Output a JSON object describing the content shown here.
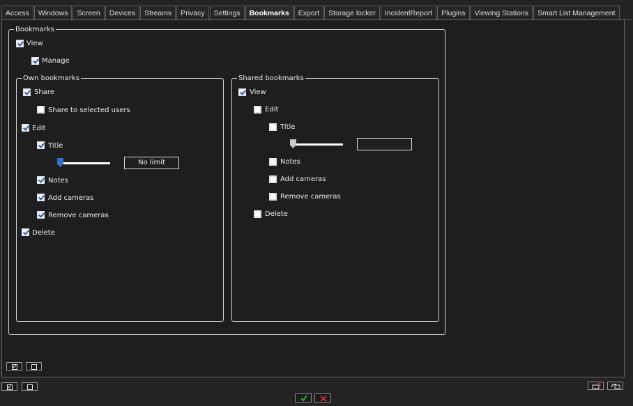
{
  "tabs": [
    {
      "label": "Access"
    },
    {
      "label": "Windows"
    },
    {
      "label": "Screen"
    },
    {
      "label": "Devices"
    },
    {
      "label": "Streams"
    },
    {
      "label": "Privacy"
    },
    {
      "label": "Settings"
    },
    {
      "label": "Bookmarks",
      "active": true
    },
    {
      "label": "Export"
    },
    {
      "label": "Storage locker"
    },
    {
      "label": "IncidentReport"
    },
    {
      "label": "Plugins"
    },
    {
      "label": "Viewing Stations"
    },
    {
      "label": "Smart List Management"
    }
  ],
  "bookmarks": {
    "title": "Bookmarks",
    "view": {
      "label": "View",
      "checked": true
    },
    "manage": {
      "label": "Manage",
      "checked": true
    }
  },
  "own": {
    "title": "Own bookmarks",
    "share": {
      "label": "Share",
      "checked": true
    },
    "share_selected": {
      "label": "Share to selected users",
      "checked": false
    },
    "edit": {
      "label": "Edit",
      "checked": true
    },
    "title_cb": {
      "label": "Title",
      "checked": true
    },
    "slider_value": "No limit",
    "slider_level": 0,
    "notes": {
      "label": "Notes",
      "checked": true
    },
    "add_cameras": {
      "label": "Add cameras",
      "checked": true
    },
    "remove_cameras": {
      "label": "Remove cameras",
      "checked": true
    },
    "delete": {
      "label": "Delete",
      "checked": true
    }
  },
  "shared": {
    "title": "Shared bookmarks",
    "view": {
      "label": "View",
      "checked": true
    },
    "edit": {
      "label": "Edit",
      "checked": false
    },
    "title_cb": {
      "label": "Title",
      "checked": false
    },
    "slider_value": "",
    "slider_level": 0,
    "notes": {
      "label": "Notes",
      "checked": false
    },
    "add_cameras": {
      "label": "Add cameras",
      "checked": false
    },
    "remove_cameras": {
      "label": "Remove cameras",
      "checked": false
    },
    "delete": {
      "label": "Delete",
      "checked": false
    }
  },
  "colors": {
    "accent": "#1e5fbf",
    "ok": "#27c227",
    "cancel": "#e03030",
    "background": "#232323"
  },
  "icons": {
    "select_all": "check-all-icon",
    "deselect_all": "uncheck-all-icon",
    "ok": "checkmark-icon",
    "cancel": "close-icon",
    "left_tool": "window-export-icon",
    "right_tool": "window-refresh-icon"
  }
}
